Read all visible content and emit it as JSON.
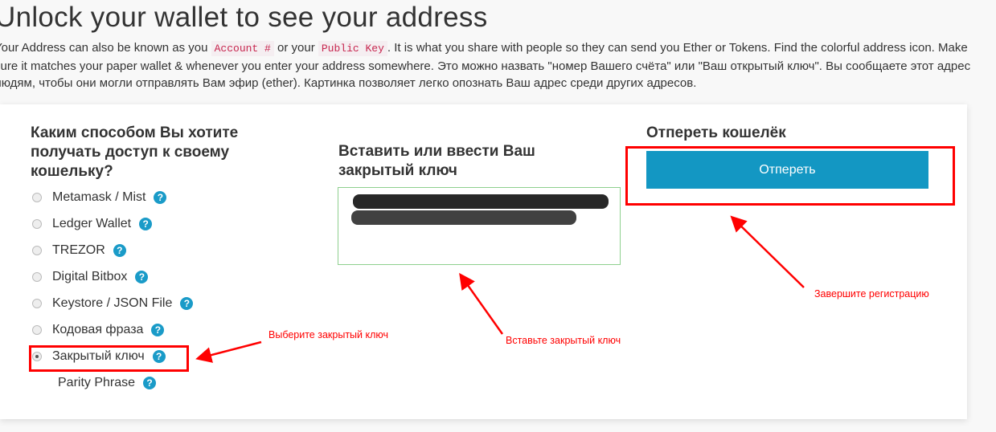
{
  "page": {
    "title": "Unlock your wallet to see your address",
    "intro": {
      "part1": "Your Address can also be known as you ",
      "code1": "Account #",
      "part2": " or your ",
      "code2": "Public Key",
      "part3": ". It is what you share with people so they can send you Ether or Tokens. Find the colorful address icon. Make sure it matches your paper wallet & whenever you enter your address somewhere. Это можно назвать \"номер Вашего счёта\" или \"Ваш открытый ключ\". Вы сообщаете этот адрес людям, чтобы они могли отправлять Вам эфир (ether). Картинка позволяет легко опознать Ваш адрес среди других адресов."
    }
  },
  "access": {
    "heading": "Каким способом Вы хотите получать доступ к своему кошельку?",
    "options": [
      {
        "label": "Metamask / Mist",
        "selected": false
      },
      {
        "label": "Ledger Wallet",
        "selected": false
      },
      {
        "label": "TREZOR",
        "selected": false
      },
      {
        "label": "Digital Bitbox",
        "selected": false
      },
      {
        "label": "Keystore / JSON File",
        "selected": false
      },
      {
        "label": "Кодовая фраза",
        "selected": false
      },
      {
        "label": "Закрытый ключ",
        "selected": true
      }
    ],
    "extra_option": "Parity Phrase",
    "help_glyph": "?"
  },
  "key_entry": {
    "heading": "Вставить или ввести Ваш закрытый ключ"
  },
  "unlock": {
    "heading": "Отпереть кошелёк",
    "button": "Отпереть"
  },
  "annotations": {
    "select": "Выберите закрытый ключ",
    "paste": "Вставьте закрытый ключ",
    "finish": "Завершите регистрацию"
  },
  "colors": {
    "accent": "#1397c3",
    "annotation": "#ff0000",
    "textarea_border": "#8ed08e"
  }
}
